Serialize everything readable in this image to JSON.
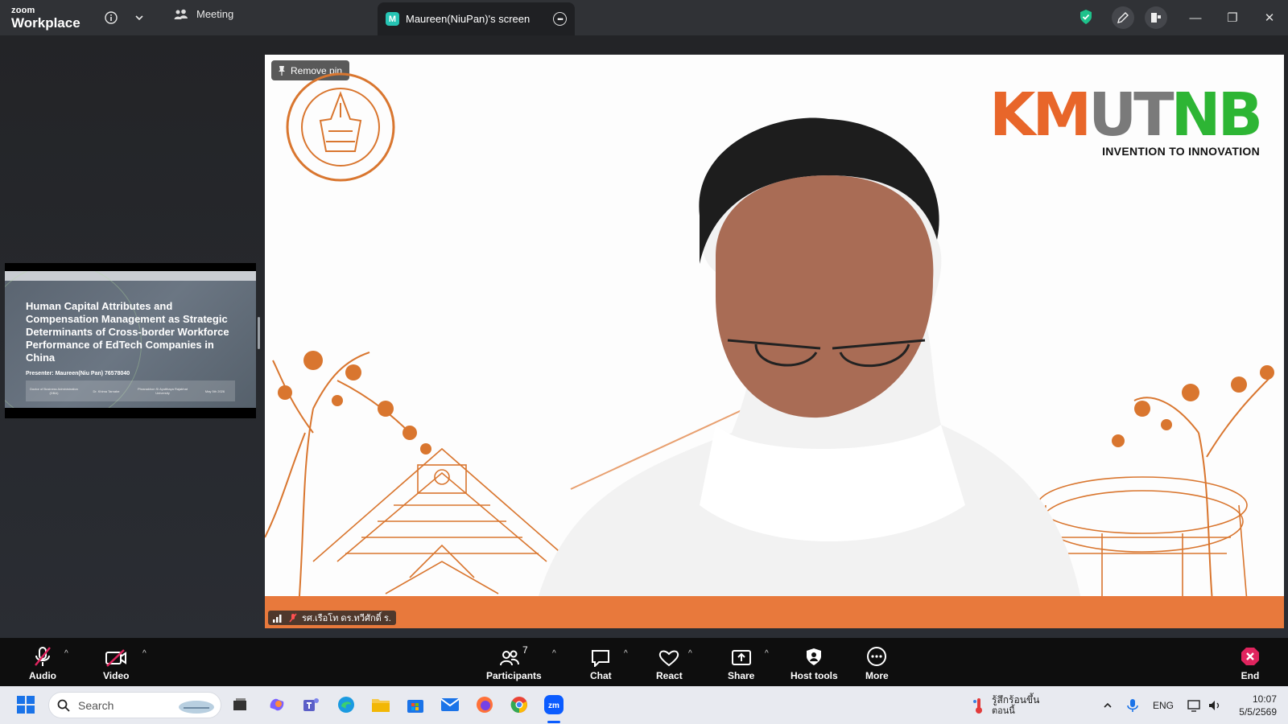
{
  "window": {
    "brand_small": "zoom",
    "brand_big": "Workplace",
    "meeting_tab_label": "Meeting",
    "screen_tab_badge": "M",
    "screen_tab_label": "Maureen(NiuPan)'s screen"
  },
  "thumbnail": {
    "title": "Human Capital Attributes and Compensation Management as Strategic Determinants of Cross-border Workforce Performance of EdTech Companies in China",
    "presenter": "Presenter: Maureen(Niu Pan) 76578040",
    "table_cols": [
      "Doctor of Business Administration (DBA)",
      "Dr. Khima Tarnabe",
      "Phranakhon Si Ayutthaya Rajabhat University",
      "May 5th 2026"
    ]
  },
  "video": {
    "remove_pin_label": "Remove pin",
    "logo_text": "KMUTNB",
    "logo_tagline": "INVENTION TO INNOVATION",
    "participant_name": "รศ.เรือโท ดร.ทวีศักดิ์ ร."
  },
  "toolbar": {
    "audio_label": "Audio",
    "video_label": "Video",
    "participants_label": "Participants",
    "participants_count": "7",
    "chat_label": "Chat",
    "react_label": "React",
    "share_label": "Share",
    "host_tools_label": "Host tools",
    "more_label": "More",
    "end_label": "End"
  },
  "taskbar": {
    "search_placeholder": "Search",
    "weather_line1": "รู้สึกร้อนขึ้น",
    "weather_line2": "ตอนนี้",
    "language": "ENG",
    "time": "10:07",
    "date": "5/5/2569"
  },
  "colors": {
    "accent_orange": "#e8793c",
    "zoom_blue": "#0b5cff",
    "end_red": "#e0245e",
    "shield_green": "#1ec28b"
  }
}
